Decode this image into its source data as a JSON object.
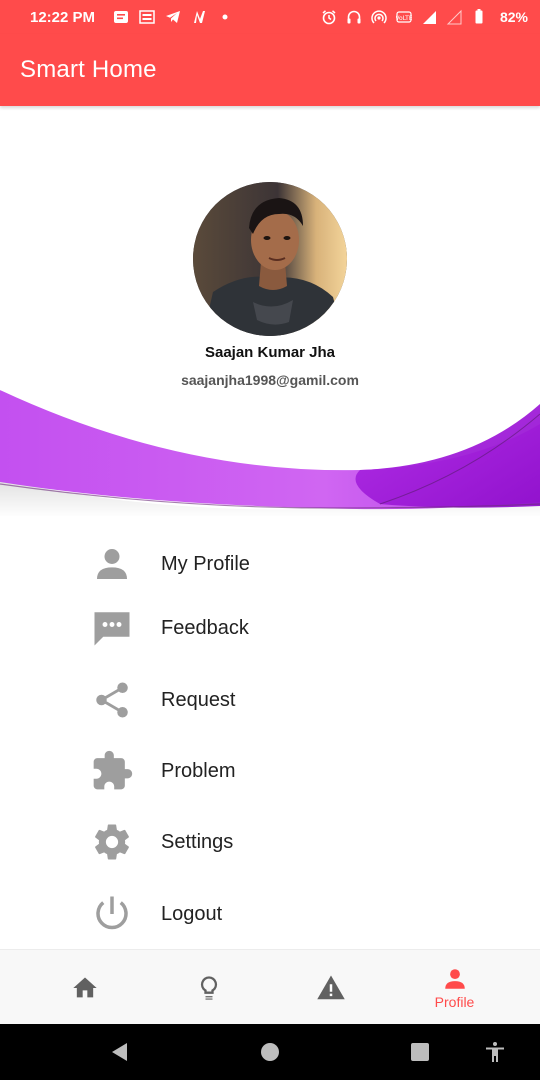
{
  "status_bar": {
    "time": "12:22 PM",
    "battery": "82%",
    "notification_icons": [
      "message-icon",
      "news-icon",
      "telegram-icon",
      "n-app-icon",
      "dot-icon"
    ],
    "system_icons": [
      "alarm-icon",
      "headphones-icon",
      "hotspot-icon",
      "volte-icon",
      "signal-4g-icon",
      "signal-empty-icon",
      "battery-icon"
    ]
  },
  "app_bar": {
    "title": "Smart Home"
  },
  "profile": {
    "name": "Saajan Kumar Jha",
    "email": "saajanjha1998@gamil.com"
  },
  "menu": {
    "items": [
      {
        "label": "My Profile",
        "icon": "person-icon"
      },
      {
        "label": "Feedback",
        "icon": "feedback-icon"
      },
      {
        "label": "Request",
        "icon": "share-icon"
      },
      {
        "label": "Problem",
        "icon": "puzzle-icon"
      },
      {
        "label": "Settings",
        "icon": "gear-icon"
      },
      {
        "label": "Logout",
        "icon": "power-icon"
      }
    ]
  },
  "bottom_nav": {
    "items": [
      {
        "icon": "home-icon",
        "label": ""
      },
      {
        "icon": "lightbulb-icon",
        "label": ""
      },
      {
        "icon": "warning-icon",
        "label": ""
      },
      {
        "icon": "person-icon",
        "label": "Profile",
        "active": true
      }
    ]
  },
  "colors": {
    "accent": "#ff4b4b",
    "wave_purple": "#c85cf0",
    "wave_deep": "#a01ed8",
    "icon_grey": "#9e9e9e"
  }
}
